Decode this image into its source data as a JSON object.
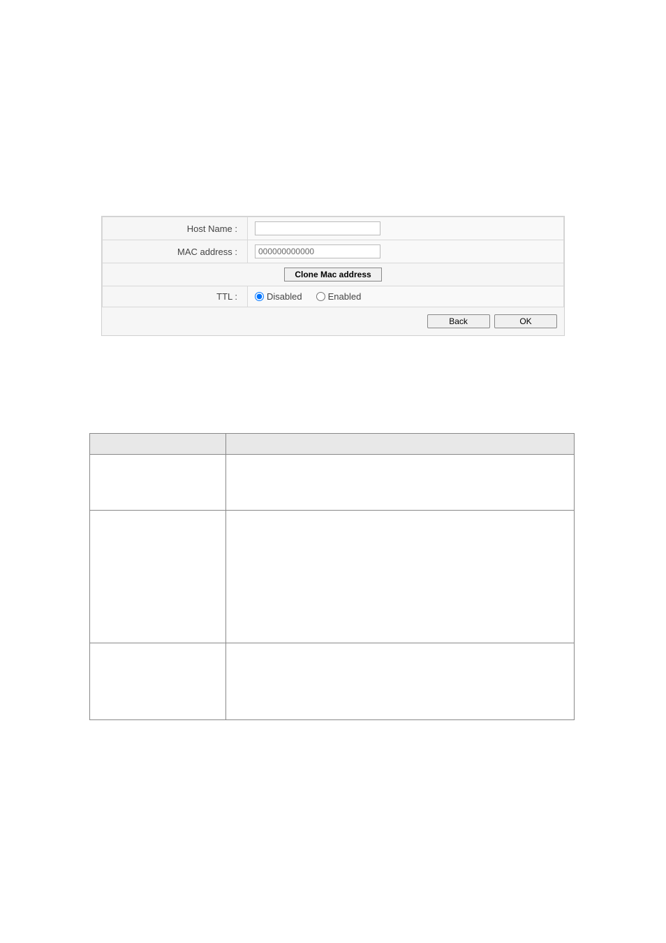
{
  "form": {
    "host_name_label": "Host Name :",
    "host_name_value": "",
    "mac_label": "MAC address :",
    "mac_value": "000000000000",
    "clone_label": "Clone Mac address",
    "ttl_label": "TTL :",
    "ttl_disabled": "Disabled",
    "ttl_enabled": "Enabled",
    "ttl_selected": "disabled"
  },
  "buttons": {
    "back": "Back",
    "ok": "OK"
  },
  "desc_table": {
    "header_item": "",
    "header_desc": "",
    "rows": [
      {
        "item": "",
        "desc": ""
      },
      {
        "item": "",
        "desc": ""
      },
      {
        "item": "",
        "desc": ""
      }
    ]
  }
}
